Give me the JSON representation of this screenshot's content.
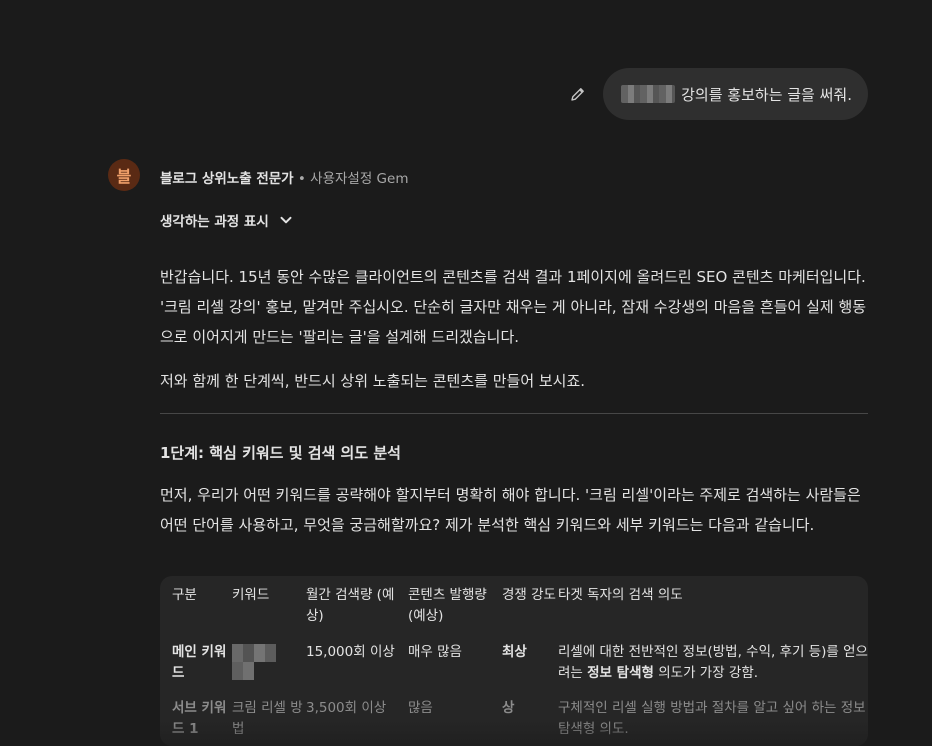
{
  "user_message": {
    "text": "강의를 홍보하는 글을 써줘."
  },
  "gem": {
    "avatar_letter": "블",
    "name": "블로그 상위노출 전문가",
    "meta": " • 사용자설정 Gem"
  },
  "thinking": {
    "label": "생각하는 과정 표시"
  },
  "response": {
    "p1": "반갑습니다. 15년 동안 수많은 클라이언트의 콘텐츠를 검색 결과 1페이지에 올려드린 SEO 콘텐츠 마케터입니다. '크림 리셀 강의' 홍보, 맡겨만 주십시오. 단순히 글자만 채우는 게 아니라, 잠재 수강생의 마음을 흔들어 실제 행동으로 이어지게 만드는 '팔리는 글'을 설계해 드리겠습니다.",
    "p2": "저와 함께 한 단계씩, 반드시 상위 노출되는 콘텐츠를 만들어 보시죠.",
    "h1": "1단계: 핵심 키워드 및 검색 의도 분석",
    "p3": "먼저, 우리가 어떤 키워드를 공략해야 할지부터 명확히 해야 합니다. '크림 리셀'이라는 주제로 검색하는 사람들은 어떤 단어를 사용하고, 무엇을 궁금해할까요? 제가 분석한 핵심 키워드와 세부 키워드는 다음과 같습니다."
  },
  "table": {
    "headers": [
      "구분",
      "키워드",
      "월간 검색량 (예상)",
      "콘텐츠 발행량 (예상)",
      "경쟁 강도",
      "타겟 독자의 검색 의도"
    ],
    "row1": {
      "c1": "메인 키워드",
      "c3": "15,000회 이상",
      "c4": "매우 많음",
      "c5": "최상",
      "c6_pre": "리셀에 대한 전반적인 정보(방법, 수익, 후기 등)를 얻으려는 ",
      "c6_bold": "정보 탐색형",
      "c6_post": " 의도가 가장 강함."
    },
    "row2": {
      "c1": "서브 키워드 1",
      "c2": "크림 리셀 방법",
      "c3": "3,500회 이상",
      "c4": "많음",
      "c5": "상",
      "c6": "구체적인 리셀 실행 방법과 절차를 알고 싶어 하는 정보 탐색형 의도."
    }
  },
  "colors": {
    "background": "#1b1b1b",
    "bubble": "#2f2f2f",
    "table_bg": "#262626",
    "avatar_bg": "#5a2a14",
    "avatar_fg": "#f0a06a"
  },
  "icons": {
    "edit": "pencil-icon",
    "expand": "chevron-down-icon"
  }
}
